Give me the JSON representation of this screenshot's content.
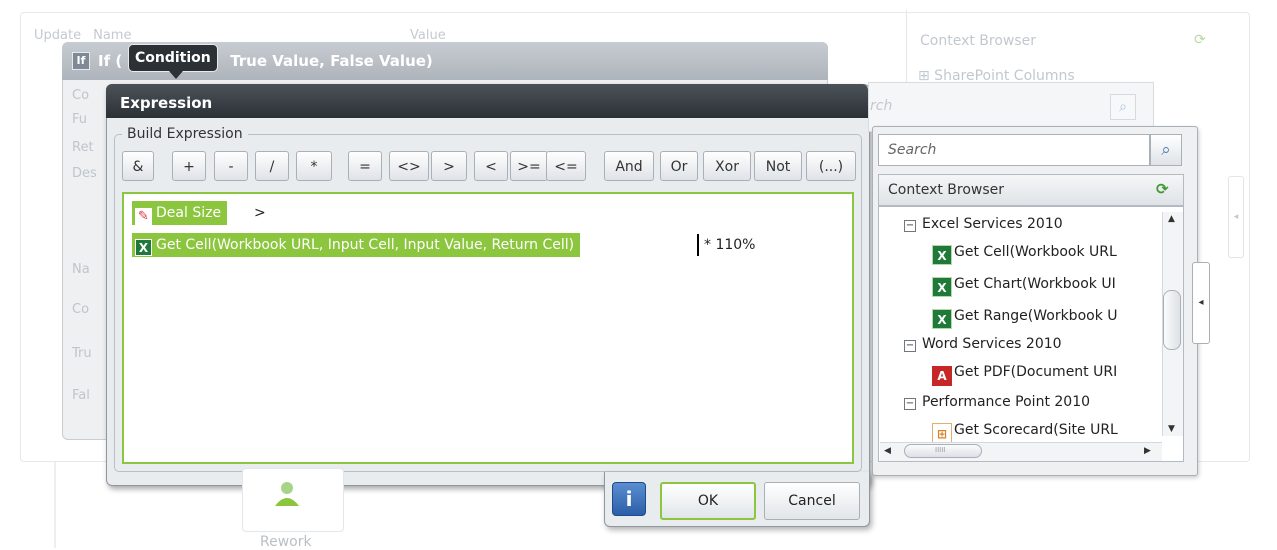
{
  "background": {
    "header_cols": [
      "Update",
      "Name"
    ],
    "value_col": "Value",
    "context_browser_label": "Context Browser",
    "sharepoint_columns": "⊞ SharePoint Columns",
    "back_search_placeholder": "rch",
    "if_left_labels": [
      "Co",
      "Fu",
      "Ret",
      "Des",
      "Na",
      "Co",
      "Tru",
      "Fal"
    ],
    "rework_label": "Rework"
  },
  "if_dialog": {
    "icon_text": "If",
    "title_prefix": "If (",
    "tooltip": "Condition",
    "title_rest": "True Value, False Value)"
  },
  "expression_dialog": {
    "title": "Expression",
    "group_label": "Build Expression",
    "operators": [
      "&",
      "+",
      "-",
      "/",
      "*",
      "=",
      "<>",
      ">",
      "<",
      ">=",
      "<=",
      "And",
      "Or",
      "Xor",
      "Not",
      "(...)"
    ],
    "line1_token": "Deal Size",
    "line1_suffix": ">",
    "line2_token": "Get Cell(Workbook URL, Input Cell, Input Value, Return Cell)",
    "line2_suffix": "* 110%"
  },
  "context_browser": {
    "search_placeholder": "Search",
    "header": "Context Browser",
    "tree": [
      {
        "label": "Excel Services 2010",
        "type": "group"
      },
      {
        "label": "Get Cell(Workbook URL",
        "type": "xls"
      },
      {
        "label": "Get Chart(Workbook UI",
        "type": "xls"
      },
      {
        "label": "Get Range(Workbook U",
        "type": "xls"
      },
      {
        "label": "Word Services 2010",
        "type": "group"
      },
      {
        "label": "Get PDF(Document URI",
        "type": "pdf"
      },
      {
        "label": "Performance Point 2010",
        "type": "group"
      },
      {
        "label": "Get Scorecard(Site URL",
        "type": "pps"
      }
    ],
    "hscroll_grip": "IIIII"
  },
  "buttons": {
    "info": "i",
    "ok": "OK",
    "cancel": "Cancel"
  },
  "colors": {
    "accent_green": "#8cc63f",
    "title_dark": "#2c3136",
    "info_blue": "#2a5ea8"
  }
}
